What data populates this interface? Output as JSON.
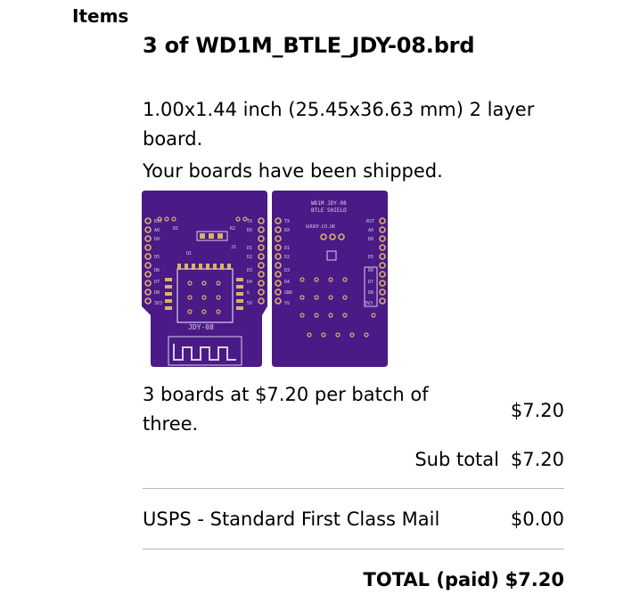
{
  "section": {
    "heading": "Items"
  },
  "order_item": {
    "title": "3 of WD1M_BTLE_JDY-08.brd",
    "description": "1.00x1.44 inch (25.45x36.63 mm) 2 layer board.",
    "status": "Your boards have been shipped.",
    "board_image": {
      "pcb_color": "#4a1a86",
      "silkscreen_color": "#d9d0ea",
      "pad_color": "#d8b36a",
      "top_silkscreen": [
        "RST",
        "A0",
        "D0",
        "D5",
        "D6",
        "D7",
        "D8",
        "3V3",
        "TX",
        "RX",
        "D1",
        "D2",
        "D3",
        "D4",
        "G",
        "5V",
        "R1",
        "R2",
        "J1",
        "Q1",
        "JDY-08"
      ],
      "bottom_silkscreen": [
        "WD1M JDY-08",
        "BTLE SHIELD",
        "GUUUY.CO.UK",
        "TX",
        "RX",
        "D1",
        "D2",
        "D3",
        "D4",
        "GND",
        "5V",
        "RST",
        "A0",
        "D0",
        "D5",
        "D6",
        "D7",
        "D8",
        "3V3"
      ]
    },
    "price_description": "3 boards at $7.20 per batch of three.",
    "price": "$7.20"
  },
  "totals": {
    "subtotal_label": "Sub total",
    "subtotal": "$7.20",
    "shipping_label": "USPS - Standard First Class Mail",
    "shipping": "$0.00",
    "total_label": "TOTAL (paid)",
    "total": "$7.20"
  }
}
